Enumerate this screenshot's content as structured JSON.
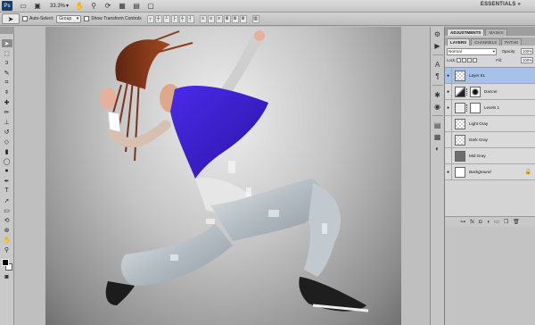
{
  "appbar": {
    "logo": "Ps",
    "zoom": "33.3%",
    "workspace": "ESSENTIALS",
    "icons": [
      "bridge-icon",
      "minibridge-icon",
      "hand-icon",
      "zoom-icon",
      "rotate-icon",
      "grid-icon",
      "arrange-icon",
      "screen-mode-icon"
    ]
  },
  "options": {
    "auto_select_label": "Auto-Select:",
    "auto_select_value": "Group",
    "transform_label": "Show Transform Controls"
  },
  "panels": {
    "tabs_top": [
      "ADJUSTMENTS",
      "MASKS"
    ],
    "tabs_layers": [
      "LAYERS",
      "CHANNELS",
      "PATHS"
    ],
    "blend_mode": "Normal",
    "opacity_label": "Opacity:",
    "opacity_value": "100%",
    "lock_label": "Lock:",
    "fill_label": "Fill:",
    "fill_value": "100%",
    "layers": [
      {
        "name": "Layer 61",
        "active": true
      },
      {
        "name": "Dancer",
        "active": false
      },
      {
        "name": "Levels 1",
        "active": false
      },
      {
        "name": "Light Gray",
        "active": false
      },
      {
        "name": "Dark Gray",
        "active": false
      },
      {
        "name": "Mid Gray",
        "active": false
      },
      {
        "name": "Background",
        "active": false
      }
    ]
  },
  "colors": {
    "shirt": "#3a1fd0",
    "hair": "#8b3a1a",
    "layer_selected": "#a6c2e8"
  }
}
